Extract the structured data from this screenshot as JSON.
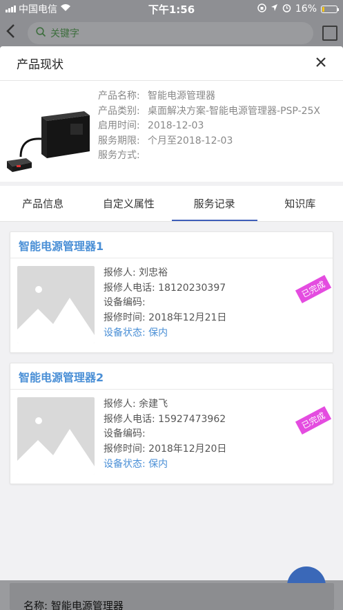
{
  "status_bar": {
    "carrier": "中国电信",
    "time": "下午1:56",
    "battery": "16%",
    "battery_level": 0.16
  },
  "top_nav": {
    "search_placeholder": "关键字"
  },
  "modal": {
    "title": "产品现状",
    "product": {
      "name_label": "产品名称:",
      "name": "智能电源管理器",
      "category_label": "产品类别:",
      "category": "桌面解决方案-智能电源管理器-PSP-25X",
      "start_label": "启用时间:",
      "start": "2018-12-03",
      "period_label": "服务期限:",
      "period": "个月至2018-12-03",
      "method_label": "服务方式:",
      "method": ""
    },
    "tabs": [
      "产品信息",
      "自定义属性",
      "服务记录",
      "知识库"
    ],
    "active_tab": 2,
    "records": [
      {
        "title": "智能电源管理器1",
        "reporter": "报修人:  刘忠裕",
        "phone": "报修人电话:  18120230397",
        "device_no": "设备编码:",
        "time": "报修时间:   2018年12月21日",
        "status": "设备状态:  保内",
        "stamp": "已完成"
      },
      {
        "title": "智能电源管理器2",
        "reporter": "报修人:  余建飞",
        "phone": "报修人电话:  15927473962",
        "device_no": "设备编码:",
        "time": "报修时间:   2018年12月20日",
        "status": "设备状态:  保内",
        "stamp": "已完成"
      }
    ]
  },
  "background": {
    "card_name": "名称:  智能电源管理器"
  }
}
